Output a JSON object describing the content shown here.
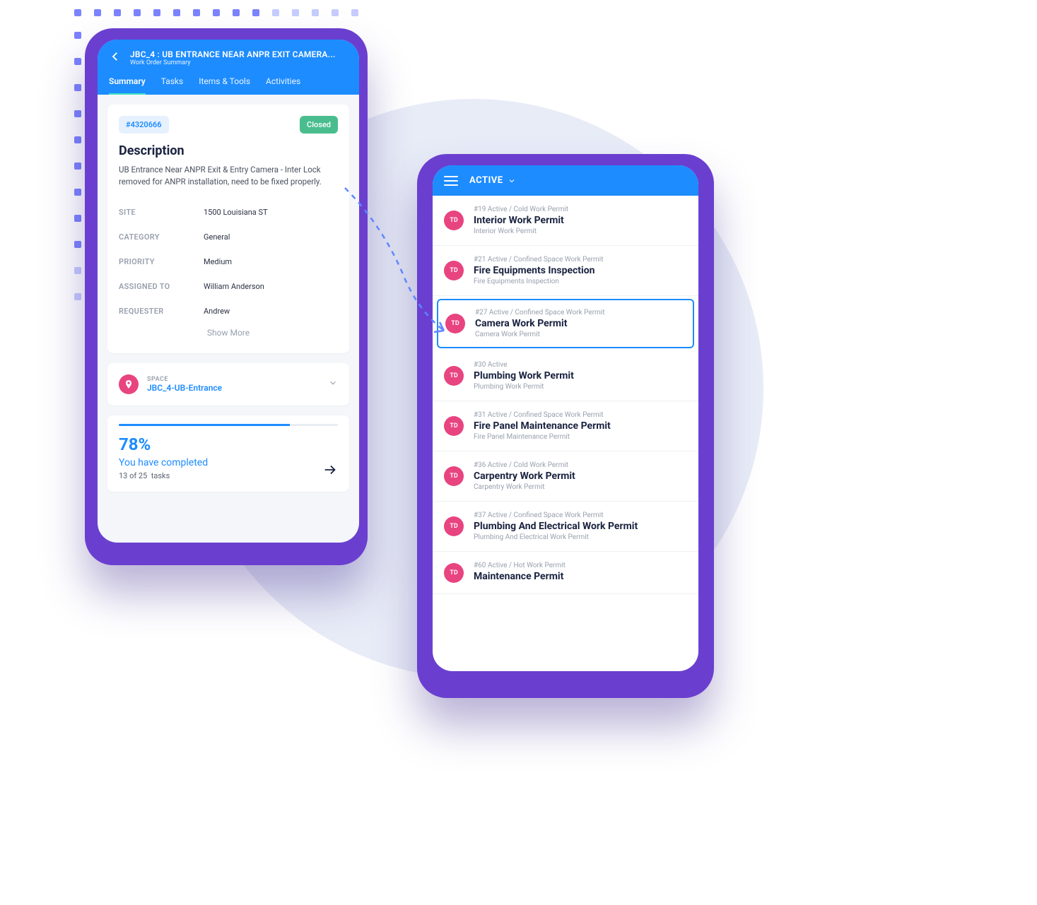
{
  "phone1": {
    "header": {
      "title": "JBC_4 : UB ENTRANCE NEAR ANPR EXIT CAMERA...",
      "subtitle": "Work Order Summary"
    },
    "tabs": [
      "Summary",
      "Tasks",
      "Items & Tools",
      "Activities"
    ],
    "active_tab": 0,
    "ticket_id": "#4320666",
    "status": "Closed",
    "description_heading": "Description",
    "description_text": "UB Entrance Near ANPR Exit & Entry Camera - Inter Lock removed for ANPR installation, need to be fixed properly.",
    "fields": [
      {
        "label": "SITE",
        "value": "1500 Louisiana ST"
      },
      {
        "label": "CATEGORY",
        "value": "General"
      },
      {
        "label": "PRIORITY",
        "value": "Medium"
      },
      {
        "label": "ASSIGNED TO",
        "value": "William Anderson"
      },
      {
        "label": "REQUESTER",
        "value": "Andrew"
      }
    ],
    "show_more": "Show More",
    "space": {
      "label": "SPACE",
      "name": "JBC_4-UB-Entrance"
    },
    "progress": {
      "percent_text": "78%",
      "percent": 78,
      "completed_text": "You have completed",
      "count_text": "13 of 25",
      "tasks_word": "tasks"
    }
  },
  "phone2": {
    "filter_label": "ACTIVE",
    "avatar_text": "TD",
    "items": [
      {
        "meta": "#19  Active / Cold Work Permit",
        "title": "Interior Work Permit",
        "sub": "Interior Work Permit",
        "selected": false
      },
      {
        "meta": "#21  Active / Confined Space Work Permit",
        "title": "Fire Equipments Inspection",
        "sub": "Fire Equipments Inspection",
        "selected": false
      },
      {
        "meta": "#27  Active / Confined Space Work Permit",
        "title": "Camera Work Permit",
        "sub": "Camera Work Permit",
        "selected": true
      },
      {
        "meta": "#30  Active",
        "title": "Plumbing Work Permit",
        "sub": "Plumbing Work Permit",
        "selected": false
      },
      {
        "meta": "#31  Active / Confined Space Work Permit",
        "title": "Fire Panel Maintenance Permit",
        "sub": "Fire Panel Maintenance Permit",
        "selected": false
      },
      {
        "meta": "#36  Active / Cold Work Permit",
        "title": "Carpentry Work Permit",
        "sub": "Carpentry Work Permit",
        "selected": false
      },
      {
        "meta": "#37  Active / Confined Space Work Permit",
        "title": "Plumbing And Electrical Work Permit",
        "sub": "Plumbing And Electrical Work Permit",
        "selected": false
      },
      {
        "meta": "#60  Active / Hot Work Permit",
        "title": "Maintenance Permit",
        "sub": "",
        "selected": false
      }
    ]
  }
}
